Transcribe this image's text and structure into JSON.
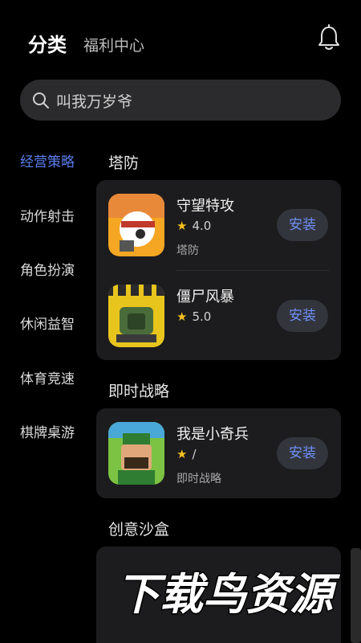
{
  "header": {
    "tab_active": "分类",
    "tab_inactive": "福利中心",
    "bell_icon": "bell-icon"
  },
  "search": {
    "placeholder": "叫我万岁爷",
    "icon": "search-icon"
  },
  "categories": [
    {
      "label": "经营策略",
      "active": true
    },
    {
      "label": "动作射击",
      "active": false
    },
    {
      "label": "角色扮演",
      "active": false
    },
    {
      "label": "休闲益智",
      "active": false
    },
    {
      "label": "体育竞速",
      "active": false
    },
    {
      "label": "棋牌桌游",
      "active": false
    }
  ],
  "sections": [
    {
      "title": "塔防",
      "apps": [
        {
          "name": "守望特攻",
          "rating": "4.0",
          "tag": "塔防",
          "button": "安装"
        },
        {
          "name": "僵尸风暴",
          "rating": "5.0",
          "tag": "",
          "button": "安装"
        }
      ]
    },
    {
      "title": "即时战略",
      "apps": [
        {
          "name": "我是小奇兵",
          "rating": "/",
          "tag": "即时战略",
          "button": "安装"
        }
      ]
    },
    {
      "title": "创意沙盒",
      "apps": []
    }
  ],
  "rating_star": "★",
  "watermark": "下载鸟资源",
  "colors": {
    "background": "#000000",
    "accent": "#5b7ff0",
    "star": "#f4c21e",
    "card": "#1c1c1e"
  }
}
